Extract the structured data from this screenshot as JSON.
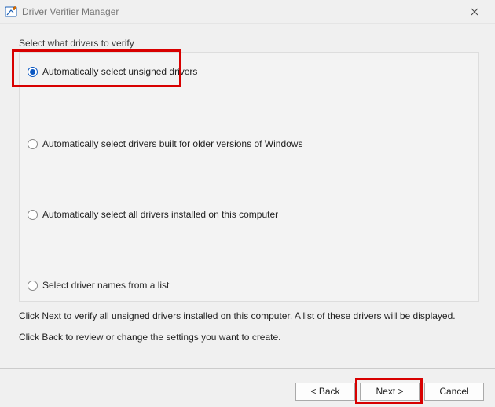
{
  "window": {
    "title": "Driver Verifier Manager"
  },
  "prompt": "Select what drivers to verify",
  "options": {
    "o1": "Automatically select unsigned drivers",
    "o2": "Automatically select drivers built for older versions of Windows",
    "o3": "Automatically select all drivers installed on this computer",
    "o4": "Select driver names from a list"
  },
  "description": {
    "line1": "Click Next to verify all unsigned drivers installed on this computer. A list of these drivers will be displayed.",
    "line2": "Click Back to review or change the settings you want to create."
  },
  "buttons": {
    "back": "< Back",
    "next": "Next >",
    "cancel": "Cancel"
  }
}
